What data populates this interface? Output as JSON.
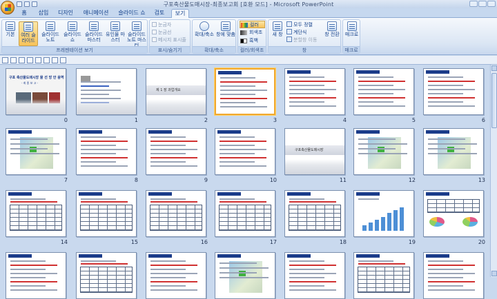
{
  "app": {
    "title": "구포축산물도매시장-최종보고회 [호환 모드] - Microsoft PowerPoint"
  },
  "tabs": [
    {
      "label": "홈"
    },
    {
      "label": "삽입"
    },
    {
      "label": "디자인"
    },
    {
      "label": "애니메이션"
    },
    {
      "label": "슬라이드 쇼"
    },
    {
      "label": "검토"
    },
    {
      "label": "보기",
      "active": true
    }
  ],
  "ribbon": {
    "views": {
      "label": "프레젠테이션 보기",
      "buttons": [
        {
          "label": "기본"
        },
        {
          "label": "여러 슬라이드",
          "selected": true
        },
        {
          "label": "슬라이드 노트"
        },
        {
          "label": "슬라이드 쇼"
        },
        {
          "label": "슬라이드 마스터"
        },
        {
          "label": "유인물 마스터"
        },
        {
          "label": "슬라이드 노트 마스터"
        }
      ]
    },
    "show_hide": {
      "label": "표시/숨기기",
      "items": [
        {
          "label": "눈금자"
        },
        {
          "label": "눈금선"
        },
        {
          "label": "메시지 표시줄"
        }
      ]
    },
    "zoom": {
      "label": "확대/축소",
      "buttons": [
        {
          "label": "확대/축소"
        },
        {
          "label": "창에 맞춤"
        }
      ]
    },
    "color": {
      "label": "컬러/회색조",
      "items": [
        {
          "label": "컬러",
          "selected": true
        },
        {
          "label": "회색조"
        },
        {
          "label": "흑백"
        }
      ]
    },
    "window": {
      "label": "창",
      "new_window": "새 창",
      "arrange_all": "모두 정렬",
      "cascade": "계단식",
      "move_split": "분할창 이동",
      "switch": "창 전환"
    },
    "macros": {
      "label": "매크로",
      "button": "매크로"
    }
  },
  "slides": [
    {
      "number": "0",
      "kind": "cover",
      "title": "구포 축산물도매시장 물 선 방 안 용역",
      "subtitle": "- 최 종 보 고 -"
    },
    {
      "number": "1",
      "kind": "toc"
    },
    {
      "number": "2",
      "kind": "section",
      "title": "제 1 장 과업개요"
    },
    {
      "number": "3",
      "kind": "text",
      "selected": true
    },
    {
      "number": "4",
      "kind": "text"
    },
    {
      "number": "5",
      "kind": "text"
    },
    {
      "number": "6",
      "kind": "text"
    },
    {
      "number": "7",
      "kind": "map"
    },
    {
      "number": "8",
      "kind": "text"
    },
    {
      "number": "9",
      "kind": "text"
    },
    {
      "number": "10",
      "kind": "text"
    },
    {
      "number": "11",
      "kind": "section",
      "title": "구포축산물도매시장"
    },
    {
      "number": "12",
      "kind": "map"
    },
    {
      "number": "13",
      "kind": "map"
    },
    {
      "number": "14",
      "kind": "table"
    },
    {
      "number": "15",
      "kind": "table"
    },
    {
      "number": "16",
      "kind": "table"
    },
    {
      "number": "17",
      "kind": "table"
    },
    {
      "number": "18",
      "kind": "table"
    },
    {
      "number": "19",
      "kind": "chart"
    },
    {
      "number": "20",
      "kind": "pie"
    },
    {
      "number": "",
      "kind": "text"
    },
    {
      "number": "",
      "kind": "table"
    },
    {
      "number": "",
      "kind": "text"
    },
    {
      "number": "",
      "kind": "map"
    },
    {
      "number": "",
      "kind": "text"
    },
    {
      "number": "",
      "kind": "table"
    },
    {
      "number": "",
      "kind": "text"
    }
  ]
}
